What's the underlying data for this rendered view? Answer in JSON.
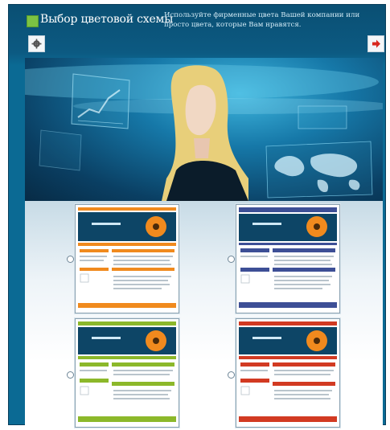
{
  "header": {
    "title": "Выбор цветовой схемы",
    "description": "Используйте фирменные цвета Вашей компании или просто цвета, которые Вам нравятся."
  },
  "nav": {
    "left_icon": "gear-icon",
    "right_icon": "arrow-right-icon"
  },
  "schemes": [
    {
      "id": "orange",
      "accent": "#f08a1e"
    },
    {
      "id": "blue",
      "accent": "#3d4f96"
    },
    {
      "id": "green",
      "accent": "#8cb82a"
    },
    {
      "id": "red",
      "accent": "#d23a22"
    }
  ],
  "colors": {
    "frame": "#0b5a82",
    "title_square": "#7cc243"
  }
}
